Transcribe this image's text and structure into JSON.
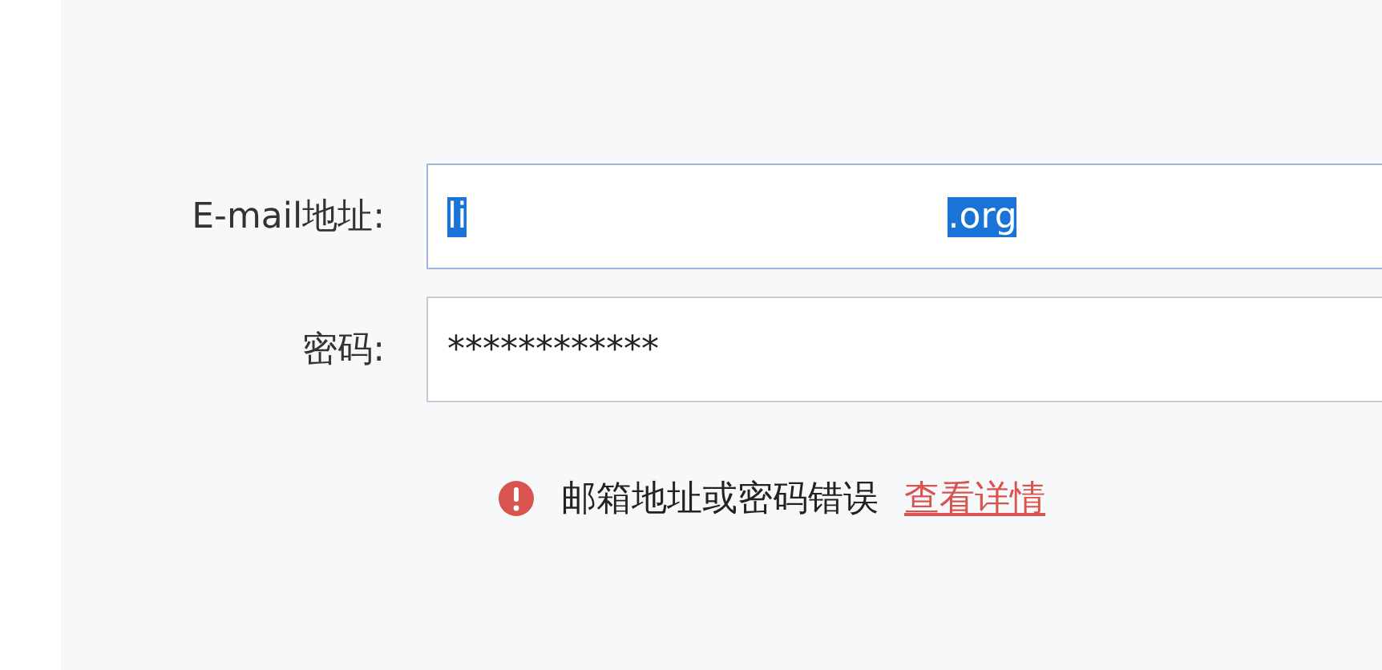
{
  "form": {
    "fields": [
      {
        "kind": "email",
        "label": "E-mail地址:",
        "value_parts": [
          "li",
          ".org"
        ],
        "selected": true
      },
      {
        "kind": "password",
        "label": "密码:",
        "value_parts": [
          "************"
        ],
        "selected": false
      }
    ]
  },
  "error": {
    "message": "邮箱地址或密码错误",
    "link": "查看详情"
  }
}
